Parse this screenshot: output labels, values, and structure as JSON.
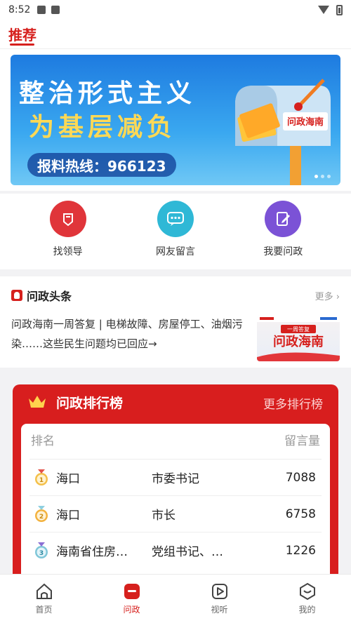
{
  "status_bar": {
    "time": "8:52"
  },
  "top_tab": {
    "label": "推荐"
  },
  "banner": {
    "line1": "整治形式主义",
    "line2": "为基层减负",
    "hotline": "报料热线：966123",
    "logo_text": "问政海南"
  },
  "quick": [
    {
      "label": "找领导",
      "color": "#e0353a",
      "icon": "leader-icon"
    },
    {
      "label": "网友留言",
      "color": "#2fb8d6",
      "icon": "chat-icon"
    },
    {
      "label": "我要问政",
      "color": "#7b52d6",
      "icon": "edit-icon"
    }
  ],
  "headline": {
    "section_title": "问政头条",
    "more": "更多 ›",
    "text": "问政海南一周答复 | 电梯故障、房屋停工、油烟污染……这些民生问题均已回应→",
    "thumb_tag": "一周答复",
    "thumb_title": "问政海南"
  },
  "ranking": {
    "title": "问政排行榜",
    "more": "更多排行榜",
    "head_rank": "排名",
    "head_count": "留言量",
    "rows": [
      {
        "rank": "1",
        "name": "海口",
        "title": "市委书记",
        "count": "7088"
      },
      {
        "rank": "2",
        "name": "海口",
        "title": "市长",
        "count": "6758"
      },
      {
        "rank": "3",
        "name": "海南省住房…",
        "title": "党组书记、…",
        "count": "1226"
      }
    ]
  },
  "nav": [
    {
      "label": "首页",
      "icon": "home-icon"
    },
    {
      "label": "问政",
      "icon": "wenzheng-icon"
    },
    {
      "label": "视听",
      "icon": "play-icon"
    },
    {
      "label": "我的",
      "icon": "profile-icon"
    }
  ],
  "colors": {
    "accent": "#d6201d",
    "rank_bg": "#d81e1e"
  }
}
